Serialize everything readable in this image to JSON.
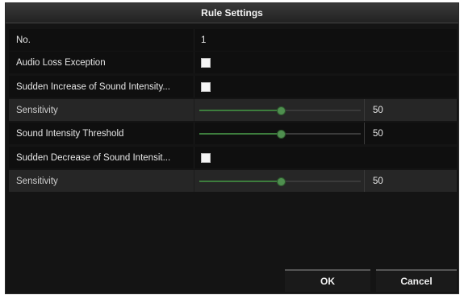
{
  "dialog": {
    "title": "Rule Settings"
  },
  "rows": {
    "no": {
      "label": "No.",
      "value": "1"
    },
    "audio_loss": {
      "label": "Audio Loss Exception",
      "checked": false
    },
    "sudden_increase": {
      "label": "Sudden Increase of Sound Intensity...",
      "checked": false
    },
    "sensitivity_1": {
      "label": "Sensitivity",
      "value": "50"
    },
    "threshold": {
      "label": "Sound Intensity Threshold",
      "value": "50"
    },
    "sudden_decrease": {
      "label": "Sudden Decrease of Sound Intensit...",
      "checked": false
    },
    "sensitivity_2": {
      "label": "Sensitivity",
      "value": "50"
    }
  },
  "sliders": {
    "sensitivity_1_level": 0.5,
    "threshold_level": 0.5,
    "sensitivity_2_level": 0.5
  },
  "buttons": {
    "ok": "OK",
    "cancel": "Cancel"
  },
  "colors": {
    "background": "#141414",
    "slider_fill": "#3d7d3d",
    "slider_thumb": "#4f8f4f"
  }
}
